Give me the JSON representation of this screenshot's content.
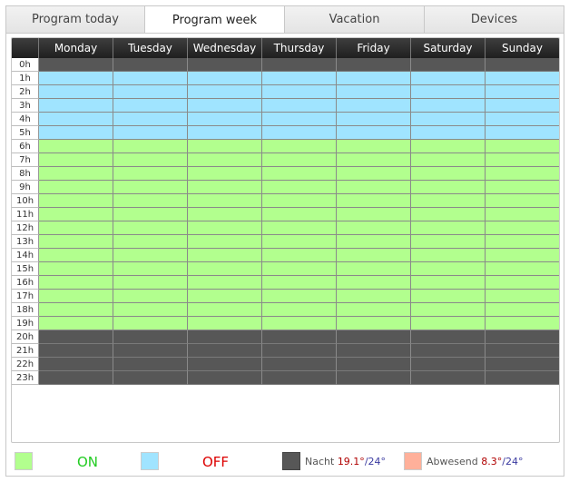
{
  "tabs": [
    {
      "label": "Program today",
      "active": false
    },
    {
      "label": "Program week",
      "active": true
    },
    {
      "label": "Vacation",
      "active": false
    },
    {
      "label": "Devices",
      "active": false
    }
  ],
  "schedule": {
    "days": [
      "Monday",
      "Tuesday",
      "Wednesday",
      "Thursday",
      "Friday",
      "Saturday",
      "Sunday"
    ],
    "hours": [
      "0h",
      "1h",
      "2h",
      "3h",
      "4h",
      "5h",
      "6h",
      "7h",
      "8h",
      "9h",
      "10h",
      "11h",
      "12h",
      "13h",
      "14h",
      "15h",
      "16h",
      "17h",
      "18h",
      "19h",
      "20h",
      "21h",
      "22h",
      "23h"
    ],
    "hour_modes": [
      "night",
      "off",
      "off",
      "off",
      "off",
      "off",
      "on",
      "on",
      "on",
      "on",
      "on",
      "on",
      "on",
      "on",
      "on",
      "on",
      "on",
      "on",
      "on",
      "on",
      "night",
      "night",
      "night",
      "night"
    ]
  },
  "legend": {
    "on": {
      "label": "ON",
      "color": "#b2ff8e",
      "text_color": "#22cc22"
    },
    "off": {
      "label": "OFF",
      "color": "#a0e4ff",
      "text_color": "#dd0000"
    },
    "night": {
      "label": "Nacht",
      "temp": "19.1°",
      "sep": "/",
      "max": "24°",
      "color": "#575757"
    },
    "away": {
      "label": "Abwesend",
      "temp": "8.3°",
      "sep": "/",
      "max": "24°",
      "color": "#ffb09a"
    }
  },
  "colors": {
    "on": "#b2ff8e",
    "off": "#a0e4ff",
    "night": "#575757",
    "away": "#ffb09a"
  }
}
